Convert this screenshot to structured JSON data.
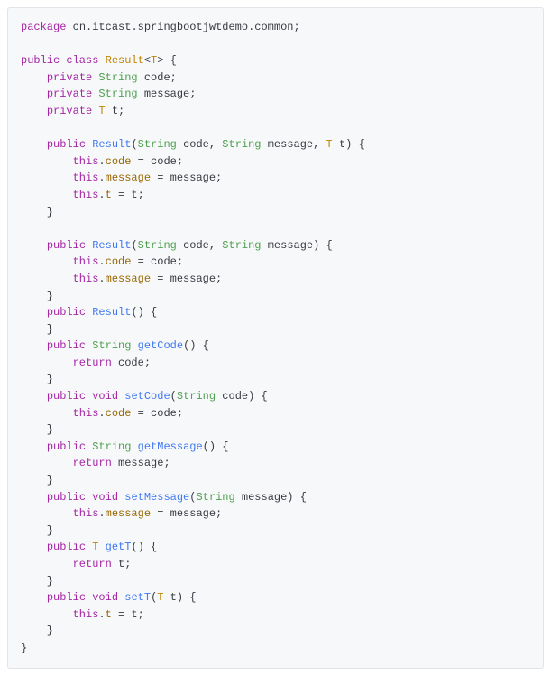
{
  "code": {
    "lines": [
      [
        {
          "t": "package",
          "c": "kw"
        },
        {
          "t": " cn",
          "c": "plain"
        },
        {
          "t": ".",
          "c": "plain"
        },
        {
          "t": "itcast",
          "c": "plain"
        },
        {
          "t": ".",
          "c": "plain"
        },
        {
          "t": "springbootjwtdemo",
          "c": "plain"
        },
        {
          "t": ".",
          "c": "plain"
        },
        {
          "t": "common",
          "c": "plain"
        },
        {
          "t": ";",
          "c": "plain"
        }
      ],
      [],
      [
        {
          "t": "public class ",
          "c": "kw"
        },
        {
          "t": "Result",
          "c": "typ"
        },
        {
          "t": "<",
          "c": "plain"
        },
        {
          "t": "T",
          "c": "typ"
        },
        {
          "t": "> {",
          "c": "plain"
        }
      ],
      [
        {
          "t": "    ",
          "c": "plain"
        },
        {
          "t": "private ",
          "c": "kw"
        },
        {
          "t": "String ",
          "c": "str"
        },
        {
          "t": "code;",
          "c": "plain"
        }
      ],
      [
        {
          "t": "    ",
          "c": "plain"
        },
        {
          "t": "private ",
          "c": "kw"
        },
        {
          "t": "String ",
          "c": "str"
        },
        {
          "t": "message;",
          "c": "plain"
        }
      ],
      [
        {
          "t": "    ",
          "c": "plain"
        },
        {
          "t": "private ",
          "c": "kw"
        },
        {
          "t": "T ",
          "c": "typ"
        },
        {
          "t": "t;",
          "c": "plain"
        }
      ],
      [],
      [
        {
          "t": "    ",
          "c": "plain"
        },
        {
          "t": "public ",
          "c": "kw"
        },
        {
          "t": "Result",
          "c": "mth"
        },
        {
          "t": "(",
          "c": "plain"
        },
        {
          "t": "String ",
          "c": "str"
        },
        {
          "t": "code, ",
          "c": "plain"
        },
        {
          "t": "String ",
          "c": "str"
        },
        {
          "t": "message, ",
          "c": "plain"
        },
        {
          "t": "T ",
          "c": "typ"
        },
        {
          "t": "t) {",
          "c": "plain"
        }
      ],
      [
        {
          "t": "        ",
          "c": "plain"
        },
        {
          "t": "this",
          "c": "kw"
        },
        {
          "t": ".",
          "c": "plain"
        },
        {
          "t": "code",
          "c": "fld"
        },
        {
          "t": " = code;",
          "c": "plain"
        }
      ],
      [
        {
          "t": "        ",
          "c": "plain"
        },
        {
          "t": "this",
          "c": "kw"
        },
        {
          "t": ".",
          "c": "plain"
        },
        {
          "t": "message",
          "c": "fld"
        },
        {
          "t": " = message;",
          "c": "plain"
        }
      ],
      [
        {
          "t": "        ",
          "c": "plain"
        },
        {
          "t": "this",
          "c": "kw"
        },
        {
          "t": ".",
          "c": "plain"
        },
        {
          "t": "t",
          "c": "fld"
        },
        {
          "t": " = t;",
          "c": "plain"
        }
      ],
      [
        {
          "t": "    }",
          "c": "plain"
        }
      ],
      [],
      [
        {
          "t": "    ",
          "c": "plain"
        },
        {
          "t": "public ",
          "c": "kw"
        },
        {
          "t": "Result",
          "c": "mth"
        },
        {
          "t": "(",
          "c": "plain"
        },
        {
          "t": "String ",
          "c": "str"
        },
        {
          "t": "code, ",
          "c": "plain"
        },
        {
          "t": "String ",
          "c": "str"
        },
        {
          "t": "message) {",
          "c": "plain"
        }
      ],
      [
        {
          "t": "        ",
          "c": "plain"
        },
        {
          "t": "this",
          "c": "kw"
        },
        {
          "t": ".",
          "c": "plain"
        },
        {
          "t": "code",
          "c": "fld"
        },
        {
          "t": " = code;",
          "c": "plain"
        }
      ],
      [
        {
          "t": "        ",
          "c": "plain"
        },
        {
          "t": "this",
          "c": "kw"
        },
        {
          "t": ".",
          "c": "plain"
        },
        {
          "t": "message",
          "c": "fld"
        },
        {
          "t": " = message;",
          "c": "plain"
        }
      ],
      [
        {
          "t": "    }",
          "c": "plain"
        }
      ],
      [
        {
          "t": "    ",
          "c": "plain"
        },
        {
          "t": "public ",
          "c": "kw"
        },
        {
          "t": "Result",
          "c": "mth"
        },
        {
          "t": "() {",
          "c": "plain"
        }
      ],
      [
        {
          "t": "    }",
          "c": "plain"
        }
      ],
      [
        {
          "t": "    ",
          "c": "plain"
        },
        {
          "t": "public ",
          "c": "kw"
        },
        {
          "t": "String ",
          "c": "str"
        },
        {
          "t": "getCode",
          "c": "mth"
        },
        {
          "t": "() {",
          "c": "plain"
        }
      ],
      [
        {
          "t": "        ",
          "c": "plain"
        },
        {
          "t": "return ",
          "c": "kw"
        },
        {
          "t": "code;",
          "c": "plain"
        }
      ],
      [
        {
          "t": "    }",
          "c": "plain"
        }
      ],
      [
        {
          "t": "    ",
          "c": "plain"
        },
        {
          "t": "public ",
          "c": "kw"
        },
        {
          "t": "void ",
          "c": "kw"
        },
        {
          "t": "setCode",
          "c": "mth"
        },
        {
          "t": "(",
          "c": "plain"
        },
        {
          "t": "String ",
          "c": "str"
        },
        {
          "t": "code) {",
          "c": "plain"
        }
      ],
      [
        {
          "t": "        ",
          "c": "plain"
        },
        {
          "t": "this",
          "c": "kw"
        },
        {
          "t": ".",
          "c": "plain"
        },
        {
          "t": "code",
          "c": "fld"
        },
        {
          "t": " = code;",
          "c": "plain"
        }
      ],
      [
        {
          "t": "    }",
          "c": "plain"
        }
      ],
      [
        {
          "t": "    ",
          "c": "plain"
        },
        {
          "t": "public ",
          "c": "kw"
        },
        {
          "t": "String ",
          "c": "str"
        },
        {
          "t": "getMessage",
          "c": "mth"
        },
        {
          "t": "() {",
          "c": "plain"
        }
      ],
      [
        {
          "t": "        ",
          "c": "plain"
        },
        {
          "t": "return ",
          "c": "kw"
        },
        {
          "t": "message;",
          "c": "plain"
        }
      ],
      [
        {
          "t": "    }",
          "c": "plain"
        }
      ],
      [
        {
          "t": "    ",
          "c": "plain"
        },
        {
          "t": "public ",
          "c": "kw"
        },
        {
          "t": "void ",
          "c": "kw"
        },
        {
          "t": "setMessage",
          "c": "mth"
        },
        {
          "t": "(",
          "c": "plain"
        },
        {
          "t": "String ",
          "c": "str"
        },
        {
          "t": "message) {",
          "c": "plain"
        }
      ],
      [
        {
          "t": "        ",
          "c": "plain"
        },
        {
          "t": "this",
          "c": "kw"
        },
        {
          "t": ".",
          "c": "plain"
        },
        {
          "t": "message",
          "c": "fld"
        },
        {
          "t": " = message;",
          "c": "plain"
        }
      ],
      [
        {
          "t": "    }",
          "c": "plain"
        }
      ],
      [
        {
          "t": "    ",
          "c": "plain"
        },
        {
          "t": "public ",
          "c": "kw"
        },
        {
          "t": "T ",
          "c": "typ"
        },
        {
          "t": "getT",
          "c": "mth"
        },
        {
          "t": "() {",
          "c": "plain"
        }
      ],
      [
        {
          "t": "        ",
          "c": "plain"
        },
        {
          "t": "return ",
          "c": "kw"
        },
        {
          "t": "t;",
          "c": "plain"
        }
      ],
      [
        {
          "t": "    }",
          "c": "plain"
        }
      ],
      [
        {
          "t": "    ",
          "c": "plain"
        },
        {
          "t": "public ",
          "c": "kw"
        },
        {
          "t": "void ",
          "c": "kw"
        },
        {
          "t": "setT",
          "c": "mth"
        },
        {
          "t": "(",
          "c": "plain"
        },
        {
          "t": "T ",
          "c": "typ"
        },
        {
          "t": "t) {",
          "c": "plain"
        }
      ],
      [
        {
          "t": "        ",
          "c": "plain"
        },
        {
          "t": "this",
          "c": "kw"
        },
        {
          "t": ".",
          "c": "plain"
        },
        {
          "t": "t",
          "c": "fld"
        },
        {
          "t": " = t;",
          "c": "plain"
        }
      ],
      [
        {
          "t": "    }",
          "c": "plain"
        }
      ],
      [
        {
          "t": "}",
          "c": "plain"
        }
      ]
    ]
  }
}
